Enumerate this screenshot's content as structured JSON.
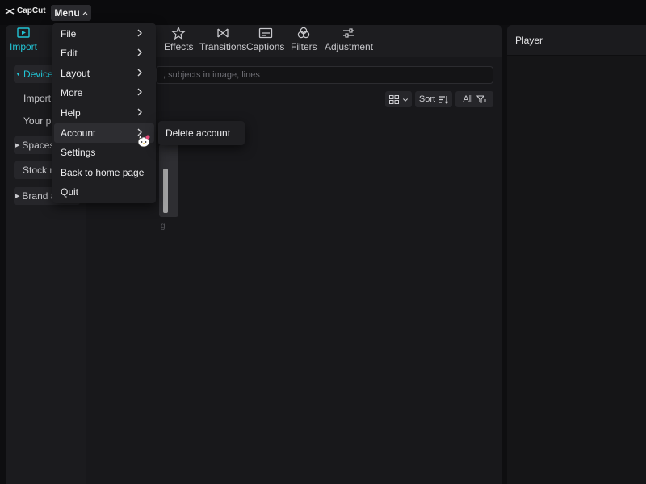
{
  "app": {
    "logo_text": "CapCut"
  },
  "titlebar": {
    "menu_label": "Menu"
  },
  "tabs": [
    {
      "label": "Import",
      "icon": "import-icon",
      "active": true
    },
    {
      "label": "Effects",
      "icon": "effects-icon"
    },
    {
      "label": "Transitions",
      "icon": "transitions-icon"
    },
    {
      "label": "Captions",
      "icon": "captions-icon"
    },
    {
      "label": "Filters",
      "icon": "filters-icon"
    },
    {
      "label": "Adjustment",
      "icon": "adjustment-icon"
    }
  ],
  "sidebar": {
    "device": "Device",
    "import": "Import",
    "your": "Your pr",
    "spaces": "Spaces",
    "stock": "Stock m",
    "brand": "Brand a"
  },
  "search": {
    "placeholder": ", subjects in image, lines"
  },
  "toolbar": {
    "sort": "Sort",
    "all": "All"
  },
  "ghost": {
    "text": "g"
  },
  "player": {
    "title": "Player"
  },
  "menu": {
    "items": [
      {
        "label": "File",
        "submenu": true
      },
      {
        "label": "Edit",
        "submenu": true
      },
      {
        "label": "Layout",
        "submenu": true
      },
      {
        "label": "More",
        "submenu": true
      },
      {
        "label": "Help",
        "submenu": true
      },
      {
        "label": "Account",
        "submenu": true,
        "hover": true
      },
      {
        "label": "Settings",
        "submenu": false
      },
      {
        "label": "Back to home page",
        "submenu": false
      },
      {
        "label": "Quit",
        "submenu": false
      }
    ],
    "account_submenu": {
      "item": "Delete account"
    }
  },
  "colors": {
    "accent": "#22c5d6",
    "background": "#0e0e10",
    "panel": "#18181b",
    "menu": "#1f1f22"
  }
}
